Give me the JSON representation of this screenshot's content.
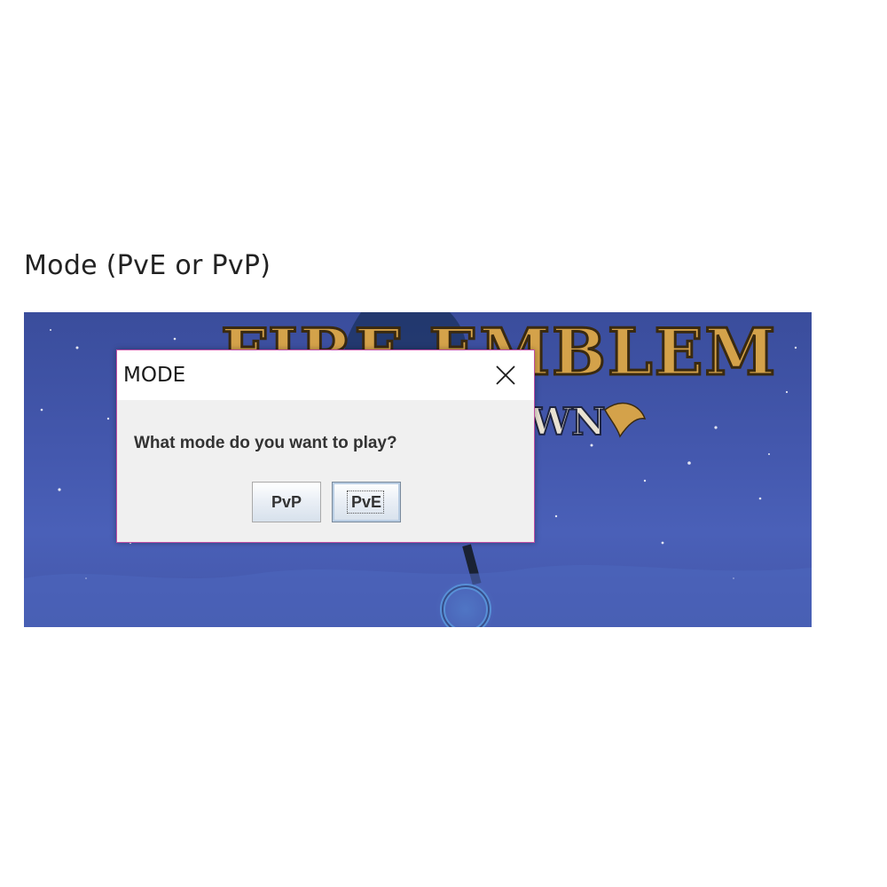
{
  "page": {
    "heading": "Mode (PvE or PvP)"
  },
  "banner": {
    "logo_title": "FIRE EMBLEM",
    "logo_subtitle": "WN"
  },
  "dialog": {
    "title": "MODE",
    "close_icon": "close-icon",
    "message": "What mode do you want to play?",
    "buttons": {
      "pvp_label": "PvP",
      "pve_label": "PvE",
      "focused": "PvE"
    },
    "border_color": "#c24fa5"
  },
  "colors": {
    "banner_sky": "#4458ae",
    "logo_gold": "#d4a24a"
  }
}
